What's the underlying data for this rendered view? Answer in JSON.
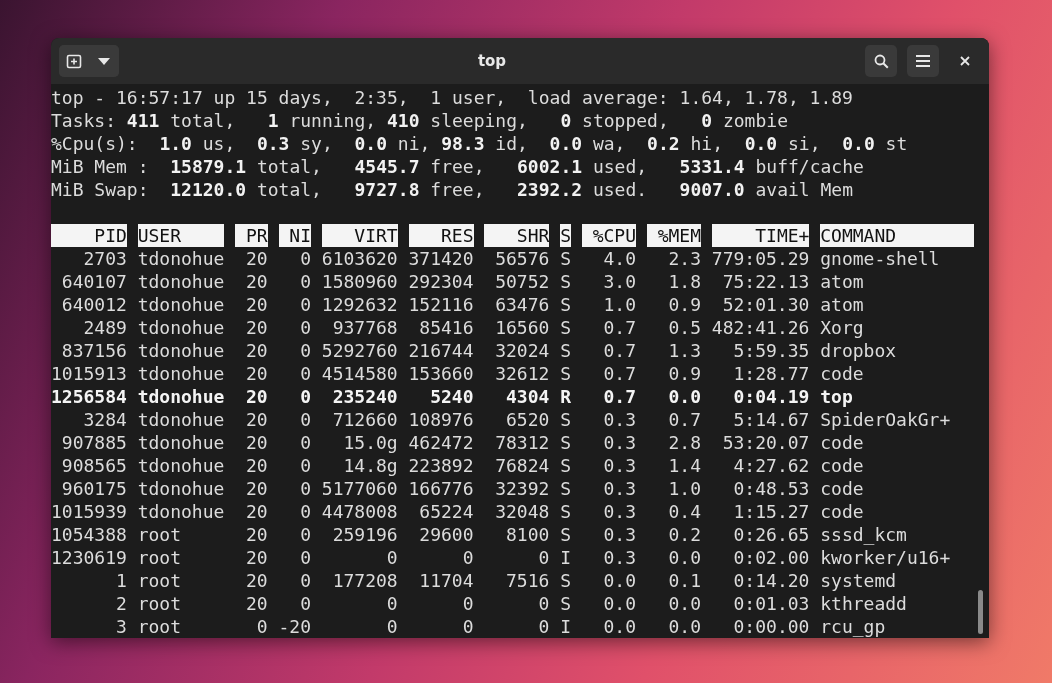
{
  "window": {
    "title": "top"
  },
  "summary": [
    "top - 16:57:17 up 15 days,  2:35,  1 user,  load average: 1.64, 1.78, 1.89",
    "Tasks: **411** total,   **1** running, **410** sleeping,   **0** stopped,   **0** zombie",
    "%Cpu(s):  **1.0** us,  **0.3** sy,  **0.0** ni, **98.3** id,  **0.0** wa,  **0.2** hi,  **0.0** si,  **0.0** st",
    "MiB Mem :  **15879.1** total,   **4545.7** free,   **6002.1** used,   **5331.4** buff/cache",
    "MiB Swap:  **12120.0** total,   **9727.8** free,   **2392.2** used.   **9007.0** avail Mem"
  ],
  "table": {
    "columns": [
      "PID",
      "USER",
      "PR",
      "NI",
      "VIRT",
      "RES",
      "SHR",
      "S",
      "%CPU",
      "%MEM",
      "TIME+",
      "COMMAND"
    ],
    "rows": [
      {
        "bold": false,
        "cells": [
          "2703",
          "tdonohue",
          "20",
          "0",
          "6103620",
          "371420",
          "56576",
          "S",
          "4.0",
          "2.3",
          "779:05.29",
          "gnome-shell"
        ]
      },
      {
        "bold": false,
        "cells": [
          "640107",
          "tdonohue",
          "20",
          "0",
          "1580960",
          "292304",
          "50752",
          "S",
          "3.0",
          "1.8",
          "75:22.13",
          "atom"
        ]
      },
      {
        "bold": false,
        "cells": [
          "640012",
          "tdonohue",
          "20",
          "0",
          "1292632",
          "152116",
          "63476",
          "S",
          "1.0",
          "0.9",
          "52:01.30",
          "atom"
        ]
      },
      {
        "bold": false,
        "cells": [
          "2489",
          "tdonohue",
          "20",
          "0",
          "937768",
          "85416",
          "16560",
          "S",
          "0.7",
          "0.5",
          "482:41.26",
          "Xorg"
        ]
      },
      {
        "bold": false,
        "cells": [
          "837156",
          "tdonohue",
          "20",
          "0",
          "5292760",
          "216744",
          "32024",
          "S",
          "0.7",
          "1.3",
          "5:59.35",
          "dropbox"
        ]
      },
      {
        "bold": false,
        "cells": [
          "1015913",
          "tdonohue",
          "20",
          "0",
          "4514580",
          "153660",
          "32612",
          "S",
          "0.7",
          "0.9",
          "1:28.77",
          "code"
        ]
      },
      {
        "bold": true,
        "cells": [
          "1256584",
          "tdonohue",
          "20",
          "0",
          "235240",
          "5240",
          "4304",
          "R",
          "0.7",
          "0.0",
          "0:04.19",
          "top"
        ]
      },
      {
        "bold": false,
        "cells": [
          "3284",
          "tdonohue",
          "20",
          "0",
          "712660",
          "108976",
          "6520",
          "S",
          "0.3",
          "0.7",
          "5:14.67",
          "SpiderOakGr+"
        ]
      },
      {
        "bold": false,
        "cells": [
          "907885",
          "tdonohue",
          "20",
          "0",
          "15.0g",
          "462472",
          "78312",
          "S",
          "0.3",
          "2.8",
          "53:20.07",
          "code"
        ]
      },
      {
        "bold": false,
        "cells": [
          "908565",
          "tdonohue",
          "20",
          "0",
          "14.8g",
          "223892",
          "76824",
          "S",
          "0.3",
          "1.4",
          "4:27.62",
          "code"
        ]
      },
      {
        "bold": false,
        "cells": [
          "960175",
          "tdonohue",
          "20",
          "0",
          "5177060",
          "166776",
          "32392",
          "S",
          "0.3",
          "1.0",
          "0:48.53",
          "code"
        ]
      },
      {
        "bold": false,
        "cells": [
          "1015939",
          "tdonohue",
          "20",
          "0",
          "4478008",
          "65224",
          "32048",
          "S",
          "0.3",
          "0.4",
          "1:15.27",
          "code"
        ]
      },
      {
        "bold": false,
        "cells": [
          "1054388",
          "root",
          "20",
          "0",
          "259196",
          "29600",
          "8100",
          "S",
          "0.3",
          "0.2",
          "0:26.65",
          "sssd_kcm"
        ]
      },
      {
        "bold": false,
        "cells": [
          "1230619",
          "root",
          "20",
          "0",
          "0",
          "0",
          "0",
          "I",
          "0.3",
          "0.0",
          "0:02.00",
          "kworker/u16+"
        ]
      },
      {
        "bold": false,
        "cells": [
          "1",
          "root",
          "20",
          "0",
          "177208",
          "11704",
          "7516",
          "S",
          "0.0",
          "0.1",
          "0:14.20",
          "systemd"
        ]
      },
      {
        "bold": false,
        "cells": [
          "2",
          "root",
          "20",
          "0",
          "0",
          "0",
          "0",
          "S",
          "0.0",
          "0.0",
          "0:01.03",
          "kthreadd"
        ]
      },
      {
        "bold": false,
        "cells": [
          "3",
          "root",
          "0",
          "-20",
          "0",
          "0",
          "0",
          "I",
          "0.0",
          "0.0",
          "0:00.00",
          "rcu_gp"
        ]
      }
    ]
  }
}
